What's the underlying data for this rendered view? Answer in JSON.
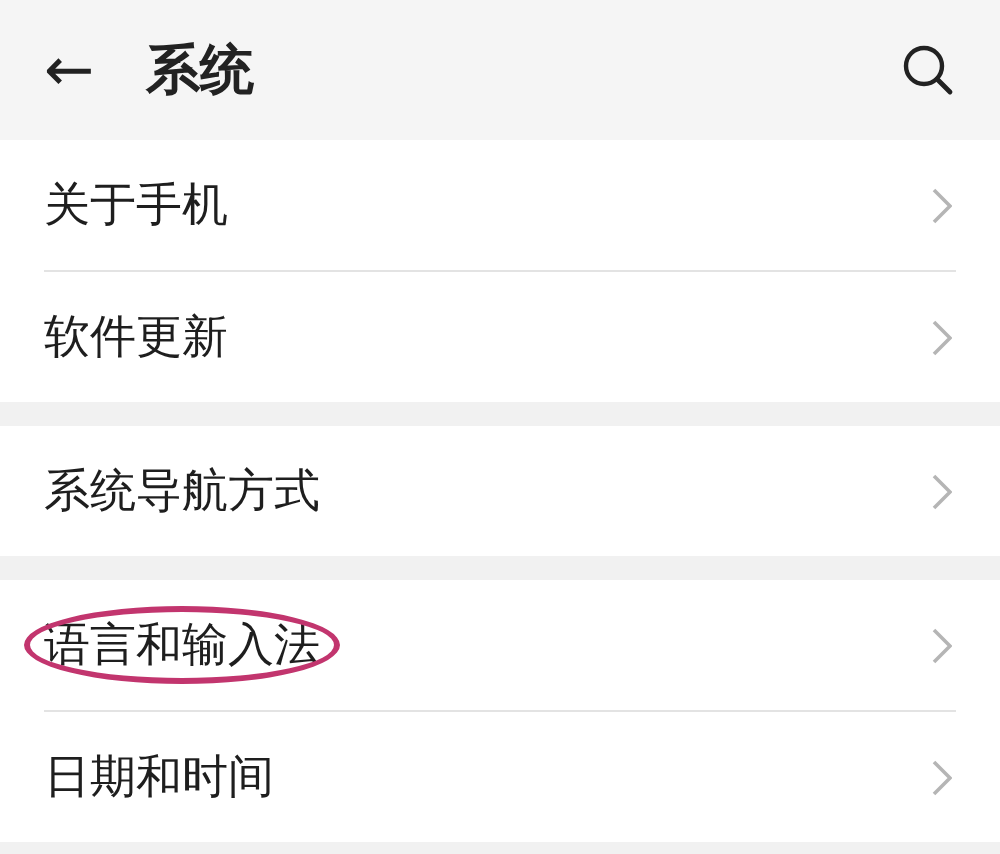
{
  "header": {
    "back": "←",
    "title": "系统"
  },
  "groups": [
    {
      "items": [
        {
          "label": "关于手机",
          "circled": false
        },
        {
          "label": "软件更新",
          "circled": false
        }
      ]
    },
    {
      "items": [
        {
          "label": "系统导航方式",
          "circled": false
        }
      ]
    },
    {
      "items": [
        {
          "label": "语言和输入法",
          "circled": true
        },
        {
          "label": "日期和时间",
          "circled": false
        }
      ]
    }
  ]
}
